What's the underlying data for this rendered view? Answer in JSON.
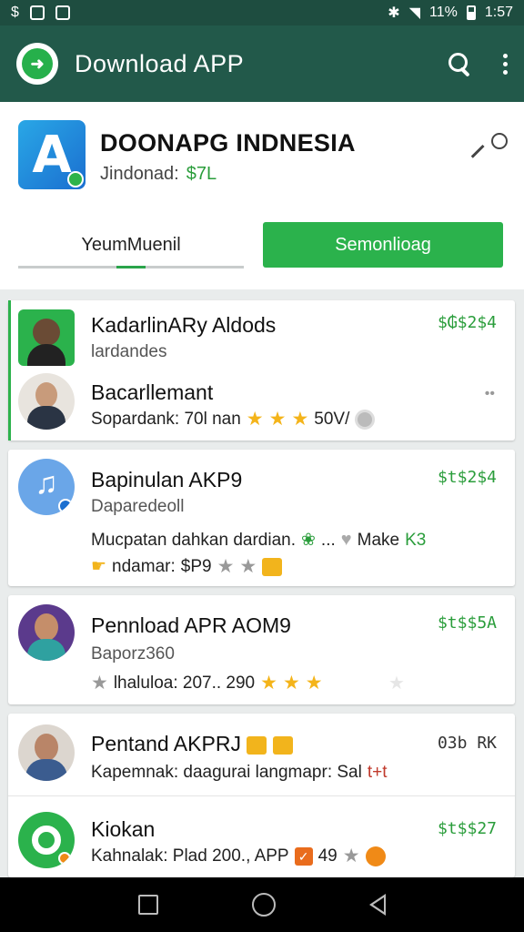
{
  "status_bar": {
    "battery": "11%",
    "time": "1:57"
  },
  "app_bar": {
    "title": "Download APP",
    "icons": [
      "download-logo-icon",
      "search-icon",
      "more-vert-icon"
    ]
  },
  "header": {
    "app_name": "DOONAPG INDNESIA",
    "sub_label": "Jindonad:",
    "sub_price": "$7L",
    "tab_left": "YeumMuenil",
    "tab_right": "Semonlioag"
  },
  "items": [
    {
      "title": "KadarlinARy Aldods",
      "subtitle": "lardandes",
      "price": "$₲$2$4"
    },
    {
      "title": "Bacarllemant",
      "meta": "Sopardank:  70l nan",
      "rating_text": "50V/"
    },
    {
      "title": "Bapinulan AKP9",
      "subtitle": "Daparedeoll",
      "price": "$t$2$4",
      "desc": "Mucpatan dahkan dardian.",
      "desc_more": "...",
      "desc_tail": "Make",
      "desc_tail2": "K3",
      "extra": "ndamar:",
      "extra_price": "$P9"
    },
    {
      "title": "Pennload APR AOM9",
      "subtitle": "Baporz360",
      "price": "$t$$5A",
      "meta": "lhaluloa: 207.. 290"
    },
    {
      "title": "Pentand AKPRJ",
      "price": "03b RK",
      "meta": "Kapemnak:  daagurai langmapr: Sal",
      "meta_tail": "t+t"
    },
    {
      "title": "Kiokan",
      "price": "$t$$27",
      "meta": "Kahnalak:  Plad 200., APP",
      "rating_text": "49"
    }
  ],
  "colors": {
    "appbar": "#22594a",
    "accent_green": "#2bb24c",
    "price_green": "#2a9d3b",
    "star": "#f4b41a"
  }
}
